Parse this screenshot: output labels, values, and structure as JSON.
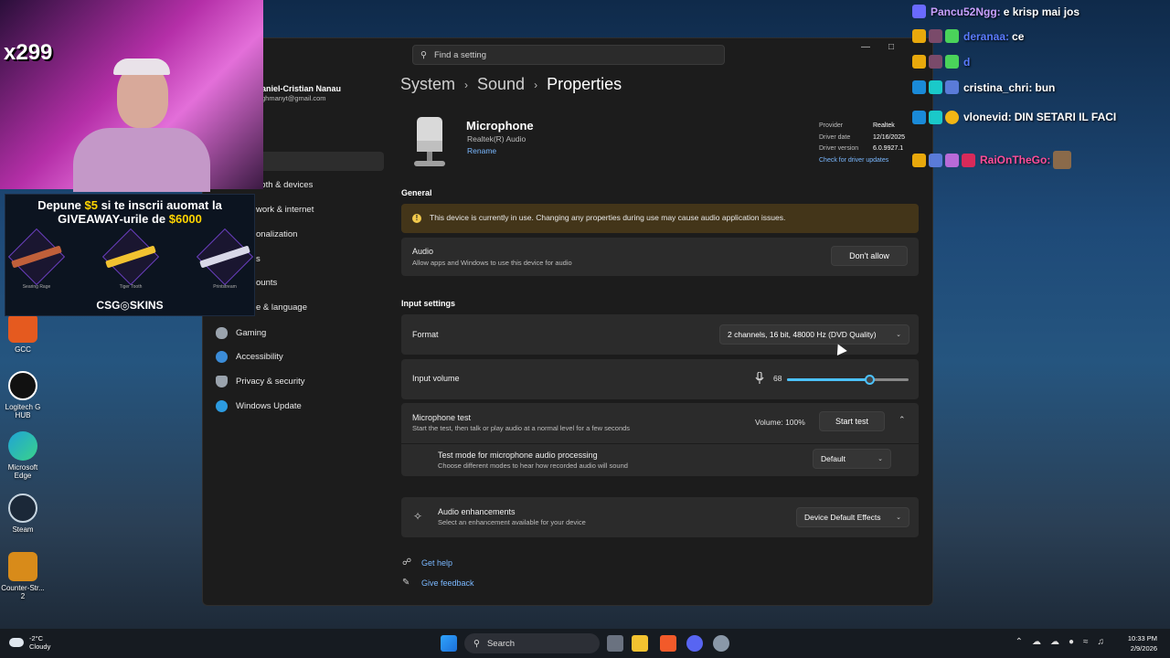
{
  "stream": {
    "count_label": "x299",
    "ad": {
      "line1_a": "Depune ",
      "line1_amount": "$5",
      "line1_b": " si te inscrii auomat la",
      "line2_a": "GIVEAWAY-urile de ",
      "line2_amount": "$6000",
      "skins": [
        "Searing Rage",
        "Tiger Tooth",
        "Printstream"
      ],
      "brand": "CSG◎SKINS"
    },
    "chat": [
      {
        "user": "Pancu52Ngg:",
        "message": "e krisp mai jos",
        "color": "#c9a0ff"
      },
      {
        "user": "deranaa:",
        "message": "ce",
        "color": "#5a7bff"
      },
      {
        "user": "d",
        "message": "",
        "color": "#5a7bff"
      },
      {
        "user": "cristina_chri:",
        "message": "bun",
        "color": "#ffffff"
      },
      {
        "user": "vlonevid:",
        "message": "DIN SETARI IL FACI",
        "color": "#ffffff"
      },
      {
        "user": "RaiOnTheGo:",
        "message": "",
        "color": "#ff4d9a"
      }
    ]
  },
  "desktop": {
    "icons": [
      {
        "label": "GCC",
        "color": "#e55a1f"
      },
      {
        "label": "Logitech G HUB",
        "color": "#111111"
      },
      {
        "label": "Microsoft Edge",
        "color": "#1fa3d6"
      },
      {
        "label": "Steam",
        "color": "#1b2838"
      },
      {
        "label": "Counter-Str... 2",
        "color": "#d88b1a"
      }
    ]
  },
  "window": {
    "search_placeholder": "Find a setting",
    "user_name": "aniel-Cristian Nanau",
    "user_email": "ghmanyt@gmail.com",
    "nav": [
      {
        "label": "ooth & devices",
        "icon": "bluetooth-icon"
      },
      {
        "label": "work & internet",
        "icon": "network-icon"
      },
      {
        "label": "onalization",
        "icon": "brush-icon"
      },
      {
        "label": "s",
        "icon": "apps-icon"
      },
      {
        "label": "ounts",
        "icon": "accounts-icon"
      },
      {
        "label": "e & language",
        "icon": "language-icon"
      },
      {
        "label": "Gaming",
        "icon": "gaming-icon"
      },
      {
        "label": "Accessibility",
        "icon": "accessibility-icon"
      },
      {
        "label": "Privacy & security",
        "icon": "shield-icon"
      },
      {
        "label": "Windows Update",
        "icon": "update-icon"
      }
    ],
    "breadcrumb": [
      "System",
      "Sound",
      "Properties"
    ],
    "device": {
      "name": "Microphone",
      "subtitle": "Realtek(R) Audio",
      "rename": "Rename",
      "driver": {
        "provider_label": "Provider",
        "provider": "Realtek",
        "date_label": "Driver date",
        "date": "12/16/2025",
        "version_label": "Driver version",
        "version": "6.0.9927.1",
        "update_link": "Check for driver updates"
      }
    },
    "general": {
      "heading": "General",
      "warning": "This device is currently in use. Changing any properties during use may cause audio application issues.",
      "audio_title": "Audio",
      "audio_sub": "Allow apps and Windows to use this device for audio",
      "audio_button": "Don't allow"
    },
    "input": {
      "heading": "Input settings",
      "format_label": "Format",
      "format_value": "2 channels, 16 bit, 48000 Hz (DVD Quality)",
      "volume_label": "Input volume",
      "volume_value": "68",
      "volume_fraction": 0.68,
      "test_title": "Microphone test",
      "test_sub": "Start the test, then talk or play audio at a normal level for a few seconds",
      "test_volume": "Volume: 100%",
      "test_button": "Start test",
      "mode_title": "Test mode for microphone audio processing",
      "mode_sub": "Choose different modes to hear how recorded audio will sound",
      "mode_value": "Default",
      "enh_title": "Audio enhancements",
      "enh_sub": "Select an enhancement available for your device",
      "enh_value": "Device Default Effects"
    },
    "footer": {
      "help": "Get help",
      "feedback": "Give feedback"
    }
  },
  "taskbar": {
    "weather_temp": "-2°C",
    "weather_desc": "Cloudy",
    "search": "Search",
    "time": "10:33 PM",
    "date": "2/9/2026"
  }
}
